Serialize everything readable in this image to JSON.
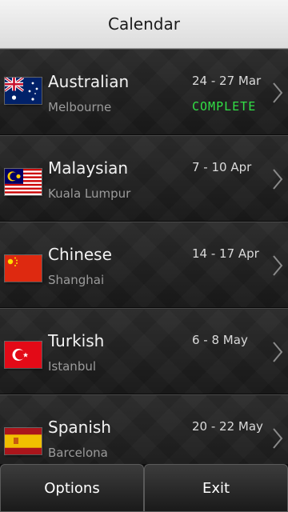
{
  "header": {
    "title": "Calendar"
  },
  "races": [
    {
      "name": "Australian",
      "city": "Melbourne",
      "dates": "24 - 27 Mar",
      "status": "COMPLETE",
      "flag": "australia-flag-icon"
    },
    {
      "name": "Malaysian",
      "city": "Kuala Lumpur",
      "dates": "7 - 10 Apr",
      "status": "",
      "flag": "malaysia-flag-icon"
    },
    {
      "name": "Chinese",
      "city": "Shanghai",
      "dates": "14 - 17 Apr",
      "status": "",
      "flag": "china-flag-icon"
    },
    {
      "name": "Turkish",
      "city": "Istanbul",
      "dates": "6 - 8 May",
      "status": "",
      "flag": "turkey-flag-icon"
    },
    {
      "name": "Spanish",
      "city": "Barcelona",
      "dates": "20 - 22 May",
      "status": "",
      "flag": "spain-flag-icon"
    }
  ],
  "softkeys": {
    "left": "Options",
    "right": "Exit"
  },
  "colors": {
    "status_complete": "#32e046",
    "header_bg": "#e8e8e8",
    "list_bg": "#1c1c1c"
  },
  "icons": {
    "row_arrow": "chevron-right-icon"
  }
}
